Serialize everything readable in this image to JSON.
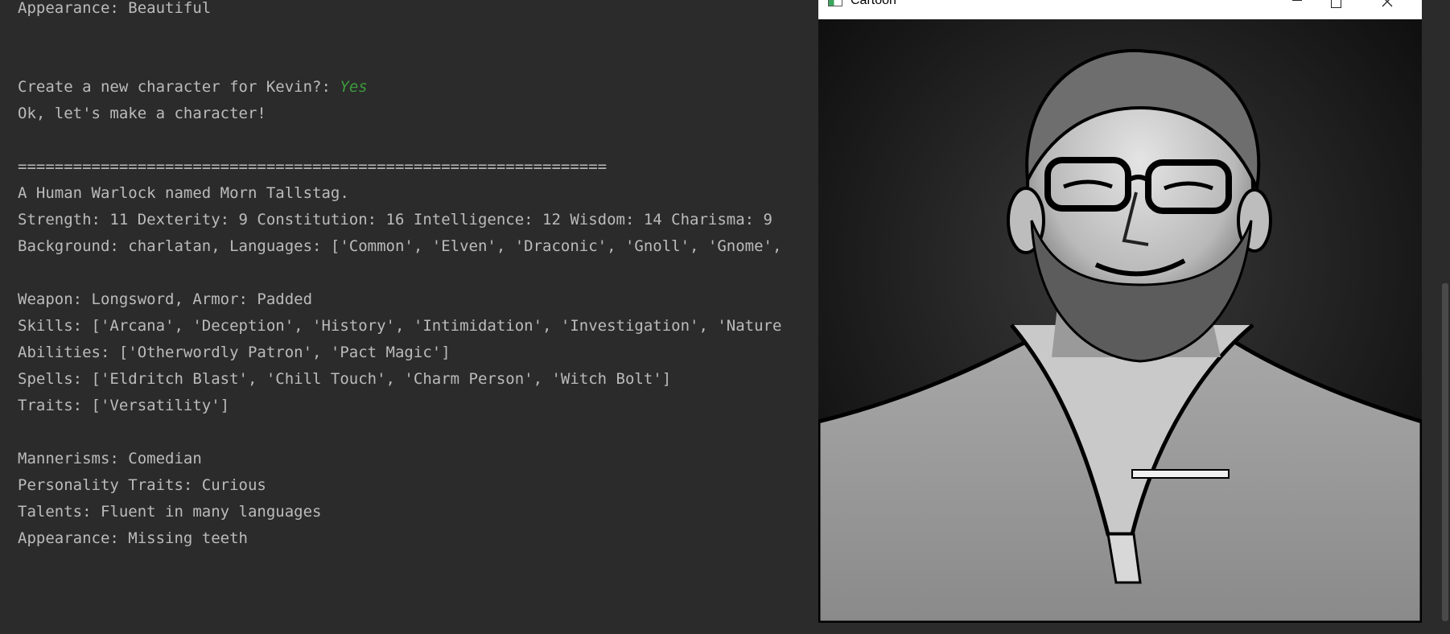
{
  "console": {
    "lines": [
      {
        "text": "Appearance: Beautiful"
      },
      {
        "text": "Create a new character for Kevin?: ",
        "input": "Yes"
      },
      {
        "text": "Ok, let's make a character!"
      },
      {
        "text": "================================================================"
      },
      {
        "text": "A Human Warlock named Morn Tallstag."
      },
      {
        "text": "Strength: 11 Dexterity: 9 Constitution: 16 Intelligence: 12 Wisdom: 14 Charisma: 9"
      },
      {
        "text": "Background: charlatan, Languages: ['Common', 'Elven', 'Draconic', 'Gnoll', 'Gnome',"
      },
      {
        "text": "Weapon: Longsword, Armor: Padded"
      },
      {
        "text": "Skills: ['Arcana', 'Deception', 'History', 'Intimidation', 'Investigation', 'Nature"
      },
      {
        "text": "Abilities: ['Otherwordly Patron', 'Pact Magic']"
      },
      {
        "text": "Spells: ['Eldritch Blast', 'Chill Touch', 'Charm Person', 'Witch Bolt']"
      },
      {
        "text": "Traits: ['Versatility']"
      },
      {
        "text": "Mannerisms: Comedian"
      },
      {
        "text": "Personality Traits: Curious"
      },
      {
        "text": "Talents: Fluent in many languages"
      },
      {
        "text": "Appearance: Missing teeth"
      }
    ]
  },
  "window": {
    "title": "Cartoon",
    "buttons": {
      "minimize": "—",
      "maximize": "□",
      "close": "✕"
    },
    "image_subject": "cartoon-filtered portrait of a bearded man with glasses"
  }
}
